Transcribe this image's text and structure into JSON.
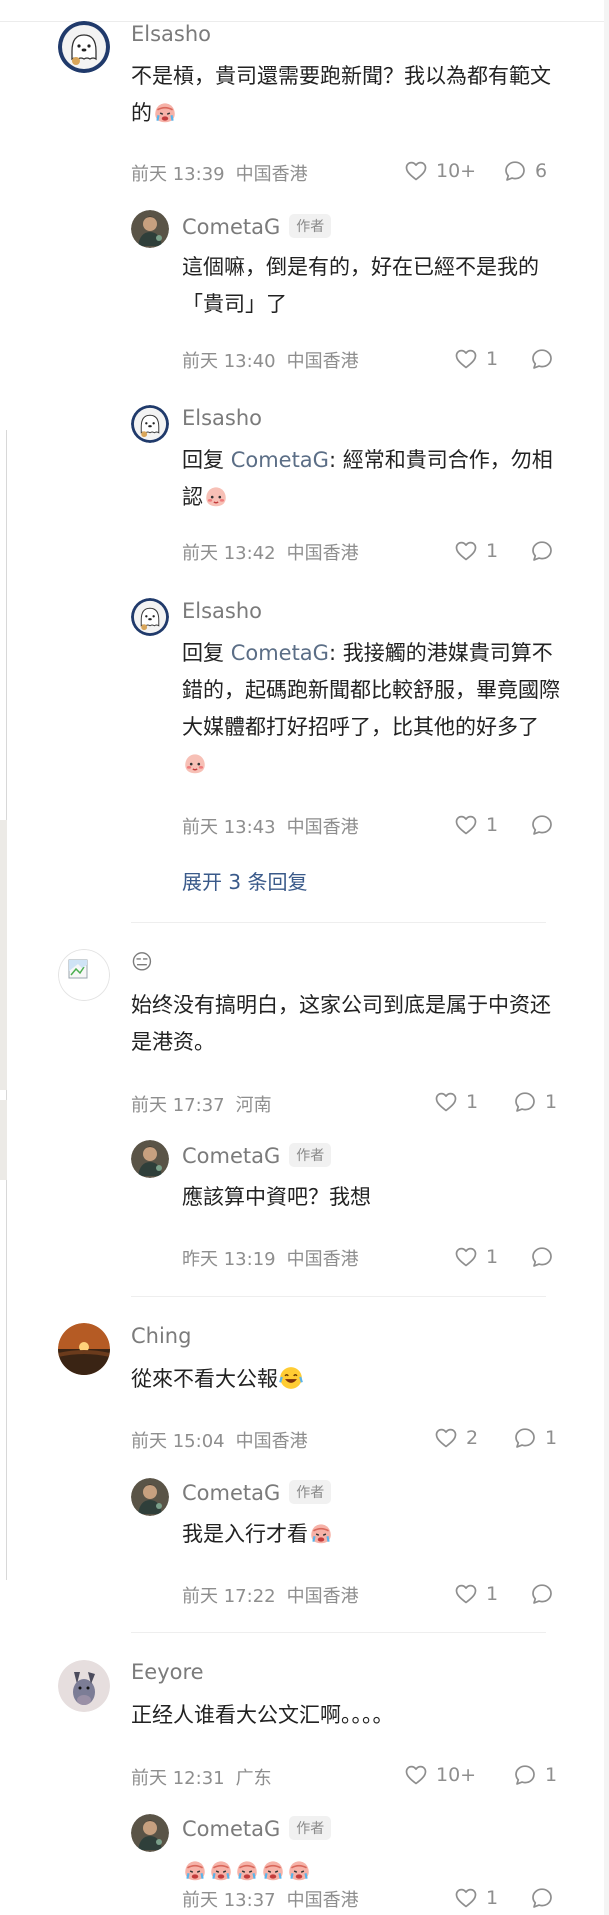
{
  "comments": [
    {
      "username": "Elsasho",
      "text": "不是槓，貴司還需要跑新聞？我以為都有範文的",
      "time": "前天 13:39",
      "location": "中国香港",
      "likes": "10+",
      "reply_count": "6",
      "replies": [
        {
          "username": "CometaG",
          "author_tag": "作者",
          "text": "這個嘛，倒是有的，好在已經不是我的「貴司」了",
          "time": "前天 13:40",
          "location": "中国香港",
          "likes": "1"
        },
        {
          "username": "Elsasho",
          "reply_prefix": "回复",
          "reply_to": "CometaG",
          "text": ": 經常和貴司合作，勿相認",
          "time": "前天 13:42",
          "location": "中国香港",
          "likes": "1"
        },
        {
          "username": "Elsasho",
          "reply_prefix": "回复",
          "reply_to": "CometaG",
          "text": ": 我接觸的港媒貴司算不錯的，起碼跑新聞都比較舒服，畢竟國際大媒體都打好招呼了，比其他的好多了",
          "time": "前天 13:43",
          "location": "中国香港",
          "likes": "1"
        }
      ],
      "expand_label": "展开 3 条回复"
    },
    {
      "username": "😑",
      "text": "始终没有搞明白，这家公司到底是属于中资还是港资。",
      "time": "前天 17:37",
      "location": "河南",
      "likes": "1",
      "reply_count": "1",
      "replies": [
        {
          "username": "CometaG",
          "author_tag": "作者",
          "text": "應該算中資吧？我想",
          "time": "昨天 13:19",
          "location": "中国香港",
          "likes": "1"
        }
      ]
    },
    {
      "username": "Ching",
      "text": "從來不看大公報",
      "time": "前天 15:04",
      "location": "中国香港",
      "likes": "2",
      "reply_count": "1",
      "replies": [
        {
          "username": "CometaG",
          "author_tag": "作者",
          "text": "我是入行才看",
          "time": "前天 17:22",
          "location": "中国香港",
          "likes": "1"
        }
      ]
    },
    {
      "username": "Eeyore",
      "text": "正经人谁看大公文汇啊。。。。",
      "time": "前天 12:31",
      "location": "广东",
      "likes": "10+",
      "reply_count": "1",
      "replies": [
        {
          "username": "CometaG",
          "author_tag": "作者",
          "text": "",
          "time": "前天 13:37",
          "location": "中国香港",
          "likes": "1"
        }
      ]
    }
  ],
  "icons": {
    "like": "heart-outline-icon",
    "reply": "speech-bubble-icon",
    "emoji_laugh_cry": "laughing-crying-emoji",
    "emoji_crying": "crying-face-emoji",
    "emoji_blush": "blushing-face-emoji"
  },
  "colors": {
    "username": "#7b7b7b",
    "text": "#222222",
    "meta": "#8e8e8e",
    "link": "#3a5a8a",
    "mention": "#5b6e86"
  }
}
